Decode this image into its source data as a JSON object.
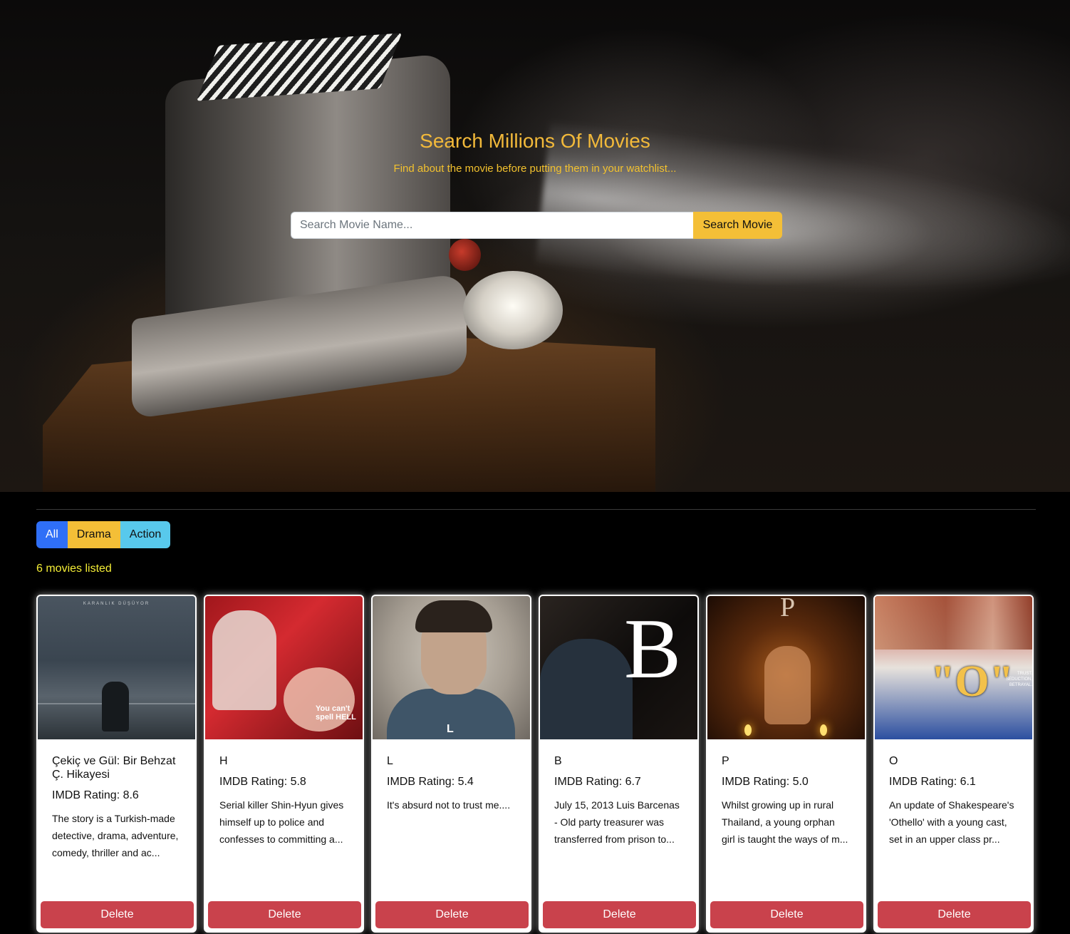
{
  "hero": {
    "title": "Search Millions Of Movies",
    "subtitle": "Find about the movie before putting them in your watchlist...",
    "search_placeholder": "Search Movie Name...",
    "search_value": "",
    "search_button": "Search Movie"
  },
  "filters": [
    {
      "label": "All",
      "color": "#2f6ff7",
      "active": true
    },
    {
      "label": "Drama",
      "color": "#f4bf37",
      "active": false
    },
    {
      "label": "Action",
      "color": "#58c9ec",
      "active": false
    }
  ],
  "movie_count_text": "6 movies listed",
  "movies": [
    {
      "title": "Çekiç ve Gül: Bir Behzat Ç. Hikayesi",
      "rating": "IMDB Rating: 8.6",
      "description": "The story is a Turkish-made detective, drama, adventure, comedy, thriller and ac...",
      "poster_text": "KARANLIK DÜŞÜYOR",
      "delete_label": "Delete"
    },
    {
      "title": "H",
      "rating": "IMDB Rating: 5.8",
      "description": "Serial killer Shin-Hyun gives himself up to police and confesses to committing a...",
      "poster_text": "You can't spell HELL",
      "delete_label": "Delete"
    },
    {
      "title": "L",
      "rating": "IMDB Rating: 5.4",
      "description": "It's absurd not to trust me....",
      "poster_text": "L",
      "delete_label": "Delete"
    },
    {
      "title": "B",
      "rating": "IMDB Rating: 6.7",
      "description": "July 15, 2013 Luis Barcenas - Old party treasurer was transferred from prison to...",
      "poster_text": "B",
      "delete_label": "Delete"
    },
    {
      "title": "P",
      "rating": "IMDB Rating: 5.0",
      "description": "Whilst growing up in rural Thailand, a young orphan girl is taught the ways of m...",
      "poster_text": "P",
      "delete_label": "Delete"
    },
    {
      "title": "O",
      "rating": "IMDB Rating: 6.1",
      "description": "An update of Shakespeare's 'Othello' with a young cast, set in an upper class pr...",
      "poster_text": "\"O\"",
      "poster_tagline": "TRUST. SEDUCTION. BETRAYAL.",
      "delete_label": "Delete"
    }
  ],
  "colors": {
    "accent_yellow": "#f4bf37",
    "delete_red": "#c9424c",
    "count_yellow": "#f5ee36"
  }
}
